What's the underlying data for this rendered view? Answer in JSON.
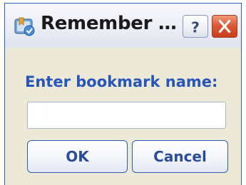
{
  "window": {
    "title": "Remember …"
  },
  "titlebar": {
    "icon": "bookmark-app-icon",
    "help_icon": "question-mark-icon",
    "close_icon": "close-icon",
    "help_label": "?"
  },
  "dialog": {
    "prompt": "Enter bookmark name:",
    "input_value": "",
    "ok_label": "OK",
    "cancel_label": "Cancel"
  },
  "colors": {
    "accent": "#2855b8",
    "close_button": "#dc5a36",
    "window_background": "#ece9d8"
  }
}
